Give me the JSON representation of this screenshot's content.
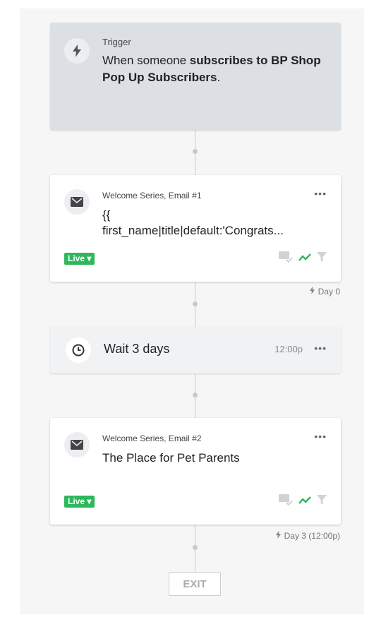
{
  "trigger": {
    "label": "Trigger",
    "text_prefix": "When someone ",
    "text_bold": "subscribes to BP Shop Pop Up Subscribers",
    "text_suffix": "."
  },
  "email1": {
    "label": "Welcome Series, Email #1",
    "subject_line1": "{{",
    "subject_line2": "first_name|title|default:'Congrats...",
    "status": "Live",
    "day": "Day 0"
  },
  "wait": {
    "text": "Wait 3 days",
    "time": "12:00p"
  },
  "email2": {
    "label": "Welcome Series, Email #2",
    "subject": "The Place for Pet Parents",
    "status": "Live",
    "day": "Day 3 (12:00p)"
  },
  "exit": {
    "label": "EXIT"
  },
  "more": "•••",
  "colors": {
    "live": "#2eb85c",
    "accent_icon": "#2eb85c"
  },
  "icons": [
    "lightning-icon",
    "envelope-icon",
    "clock-icon",
    "message-check-icon",
    "trend-icon",
    "filter-icon"
  ]
}
